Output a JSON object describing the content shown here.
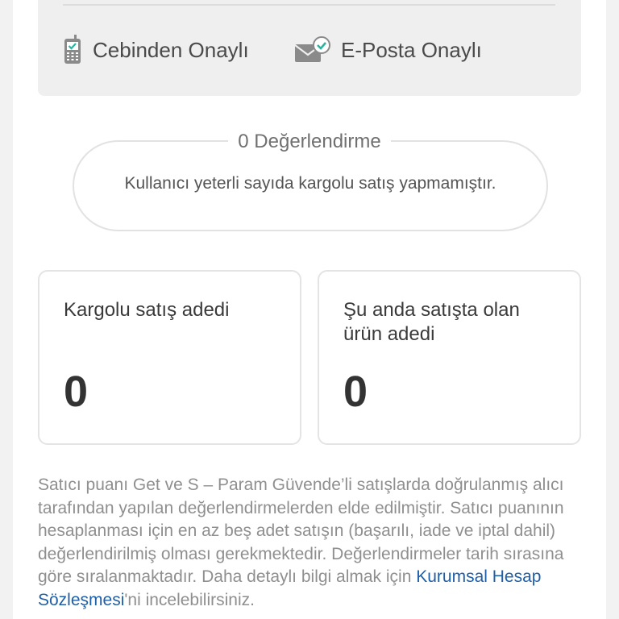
{
  "verification": {
    "items": [
      {
        "label": "Cebinden Onaylı",
        "icon": "phone-verified-icon"
      },
      {
        "label": "E-Posta Onaylı",
        "icon": "mail-verified-icon"
      }
    ]
  },
  "rating": {
    "title": "0 Değerlendirme",
    "message": "Kullanıcı yeterli sayıda kargolu satış yapmamıştır."
  },
  "stats": [
    {
      "label": "Kargolu satış adedi",
      "value": "0"
    },
    {
      "label": "Şu anda satışta olan ürün adedi",
      "value": "0"
    }
  ],
  "note": {
    "text_before": "Satıcı puanı Get ve S – Param Güvende’li satışlarda doğrulanmış alıcı tarafından yapılan değerlendirmelerden elde edilmiştir. Satıcı puanının hesaplanması için en az beş adet satışın (başarılı, iade ve iptal dahil) değerlendirilmiş olması gerekmektedir. Değerlendirmeler tarih sırasına göre sıralanmaktadır. Daha detaylı bilgi almak için ",
    "link": "Kurumsal Hesap Sözleşmesi",
    "text_after": "'ni incelebilirsiniz."
  },
  "colors": {
    "link": "#1f5fa8",
    "check": "#2bb3a0"
  }
}
